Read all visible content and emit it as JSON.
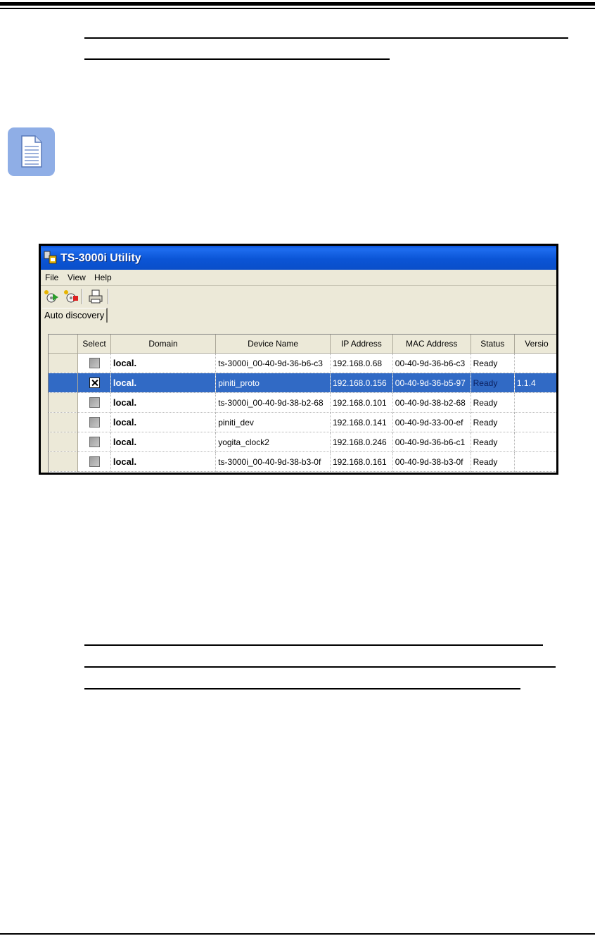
{
  "window": {
    "title": "TS-3000i Utility"
  },
  "menu": {
    "items": [
      "File",
      "View",
      "Help"
    ]
  },
  "toolbar": {
    "buttons": [
      "discover-start-icon",
      "discover-stop-icon",
      "print-icon"
    ]
  },
  "tabs": {
    "active": "Auto discovery"
  },
  "grid": {
    "columns": [
      "",
      "Select",
      "Domain",
      "Device Name",
      "IP Address",
      "MAC Address",
      "Status",
      "Versio"
    ],
    "rows": [
      {
        "selected": false,
        "checked": false,
        "domain": "local.",
        "device": "ts-3000i_00-40-9d-36-b6-c3",
        "ip": "192.168.0.68",
        "mac": "00-40-9d-36-b6-c3",
        "status": "Ready",
        "version": ""
      },
      {
        "selected": true,
        "checked": true,
        "domain": "local.",
        "device": "piniti_proto",
        "ip": "192.168.0.156",
        "mac": "00-40-9d-36-b5-97",
        "status": "Ready",
        "version": "1.1.4"
      },
      {
        "selected": false,
        "checked": false,
        "domain": "local.",
        "device": "ts-3000i_00-40-9d-38-b2-68",
        "ip": "192.168.0.101",
        "mac": "00-40-9d-38-b2-68",
        "status": "Ready",
        "version": ""
      },
      {
        "selected": false,
        "checked": false,
        "domain": "local.",
        "device": "piniti_dev",
        "ip": "192.168.0.141",
        "mac": "00-40-9d-33-00-ef",
        "status": "Ready",
        "version": ""
      },
      {
        "selected": false,
        "checked": false,
        "domain": "local.",
        "device": "yogita_clock2",
        "ip": "192.168.0.246",
        "mac": "00-40-9d-36-b6-c1",
        "status": "Ready",
        "version": ""
      },
      {
        "selected": false,
        "checked": false,
        "domain": "local.",
        "device": "ts-3000i_00-40-9d-38-b3-0f",
        "ip": "192.168.0.161",
        "mac": "00-40-9d-38-b3-0f",
        "status": "Ready",
        "version": ""
      }
    ]
  },
  "colors": {
    "titlebar": "#0a53d8",
    "selection": "#316ac5",
    "note_icon": "#8faee6"
  }
}
